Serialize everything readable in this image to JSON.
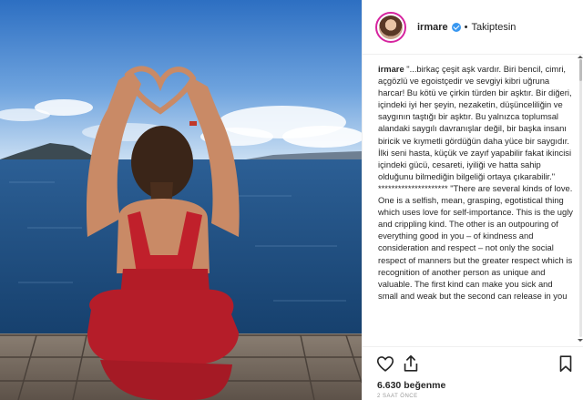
{
  "header": {
    "username": "irmare",
    "separator": "•",
    "follow_label": "Takiptesin"
  },
  "caption": {
    "author": "irmare",
    "text": "\"...birkaç çeşit aşk vardır. Biri bencil, cimri, açgözlü ve egoistçedir ve sevgiyi kibri uğruna harcar! Bu kötü ve çirkin türden bir aşktır. Bir diğeri, içindeki iyi her şeyin, nezaketin, düşünceliliğin ve saygının taştığı bir aşktır. Bu yalnızca toplumsal alandaki saygılı davranışlar değil, bir başka insanı biricik ve kıymetli gördüğün daha yüce bir saygıdır. İlki seni hasta, küçük ve zayıf yapabilir fakat ikincisi içindeki gücü, cesareti, iyiliği ve hatta sahip olduğunu bilmediğin bilgeliği ortaya çıkarabilir.\" ********************* \"There are several kinds of love. One is a selfish, mean, grasping, egotistical thing which uses love for self-importance. This is the ugly and crippling kind. The other is an outpouring of everything good in you – of kindness and consideration and respect – not only the social respect of manners but the greater respect which is recognition of another person as unique and valuable. The first kind can make you sick and small and weak but the second can release in you"
  },
  "actions": {
    "likes": "6.630 beğenme",
    "timestamp": "2 SAAT ÖNCE"
  },
  "icons": [
    "heart-icon",
    "share-icon",
    "bookmark-icon",
    "verified-icon"
  ],
  "colors": {
    "verified": "#3897f0",
    "text": "#262626",
    "avatar_ring": "#d6249f"
  }
}
